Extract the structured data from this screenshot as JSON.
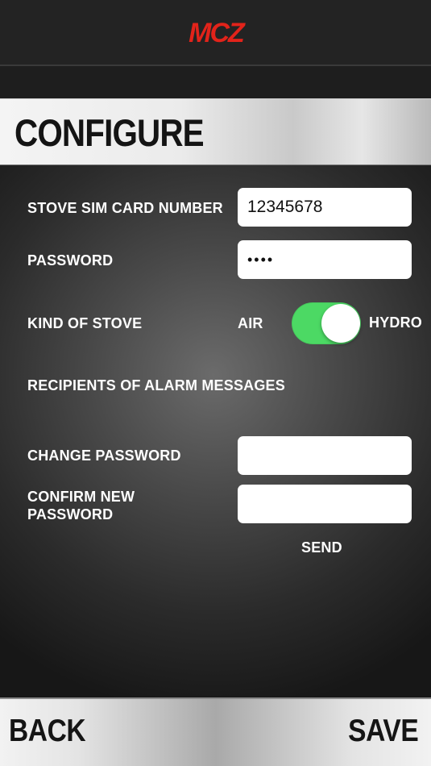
{
  "header": {
    "logo": "MCZ",
    "logo_color": "#e2231a"
  },
  "page": {
    "title": "CONFIGURE"
  },
  "form": {
    "sim_label": "STOVE SIM CARD NUMBER",
    "sim_value": "12345678",
    "password_label": "PASSWORD",
    "password_value": "••••",
    "kind_label": "KIND OF STOVE",
    "kind_option_left": "AIR",
    "kind_option_right": "HYDRO",
    "kind_toggle_on": true,
    "kind_toggle_color": "#4cd964",
    "recipients_label": "RECIPIENTS OF ALARM MESSAGES",
    "change_password_label": "CHANGE PASSWORD",
    "change_password_value": "",
    "confirm_password_label_line1": "CONFIRM NEW",
    "confirm_password_label_line2": "PASSWORD",
    "confirm_password_value": "",
    "send_label": "SEND"
  },
  "footer": {
    "back_label": "BACK",
    "save_label": "SAVE"
  }
}
